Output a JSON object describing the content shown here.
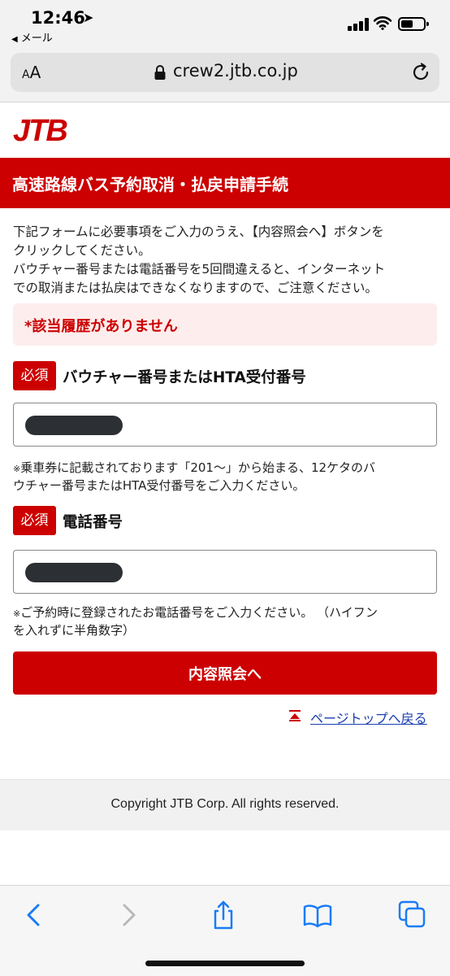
{
  "status_bar": {
    "time": "12:46",
    "location_glyph": "➤",
    "back_label": "メール"
  },
  "browser": {
    "text_size_label_small": "A",
    "text_size_label_large": "A",
    "url": "crew2.jtb.co.jp"
  },
  "page": {
    "logo_text": "JTB",
    "title": "高速路線バス予約取消・払戻申請手続",
    "intro_lines": [
      "下記フォームに必要事項をご入力のうえ、【内容照会へ】ボタンを",
      "クリックしてください。",
      "バウチャー番号または電話番号を5回間違えると、インターネット",
      "での取消または払戻はできなくなりますので、ご注意ください。"
    ],
    "error_message": "*該当履歴がありません",
    "required_badge": "必須",
    "voucher": {
      "label": "バウチャー番号またはHTA受付番号",
      "note_mark": "※",
      "note_lines": [
        "乗車券に記載されております「201〜」から始まる、12ケタのバ",
        "ウチャー番号またはHTA受付番号をご入力ください。"
      ]
    },
    "phone": {
      "label": "電話番号",
      "note_mark": "※",
      "note_lines": [
        "ご予約時に登録されたお電話番号をご入力ください。 （ハイフン",
        "を入れずに半角数字）"
      ]
    },
    "submit_label": "内容照会へ",
    "page_top_link": "ページトップへ戻る",
    "copyright": "Copyright JTB Corp. All rights reserved."
  },
  "colors": {
    "brand_red": "#cc0000",
    "error_bg": "#fdeded",
    "link_blue": "#1a3fb0",
    "ios_blue": "#1a7cf5"
  }
}
